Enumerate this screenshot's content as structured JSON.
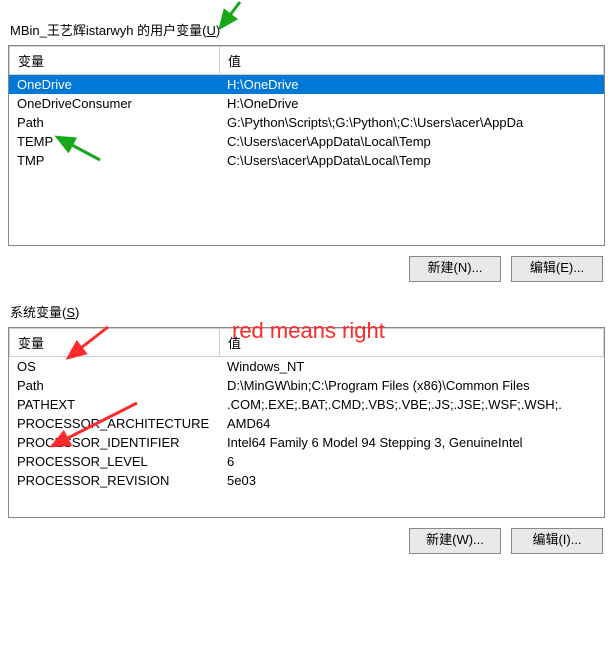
{
  "userSection": {
    "title": "MBin_王艺辉istarwyh 的用户变量(",
    "accelerator": "U",
    "closingParen": ")",
    "columns": {
      "name": "变量",
      "value": "值"
    },
    "rows": [
      {
        "name": "OneDrive",
        "value": "H:\\OneDrive",
        "selected": true
      },
      {
        "name": "OneDriveConsumer",
        "value": "H:\\OneDrive"
      },
      {
        "name": "Path",
        "value": "G:\\Python\\Scripts\\;G:\\Python\\;C:\\Users\\acer\\AppDa"
      },
      {
        "name": "TEMP",
        "value": "C:\\Users\\acer\\AppData\\Local\\Temp"
      },
      {
        "name": "TMP",
        "value": "C:\\Users\\acer\\AppData\\Local\\Temp"
      }
    ],
    "buttons": {
      "new": "新建(N)...",
      "edit": "编辑(E)..."
    }
  },
  "systemSection": {
    "title": "系统变量(",
    "accelerator": "S",
    "closingParen": ")",
    "columns": {
      "name": "变量",
      "value": "值"
    },
    "rows": [
      {
        "name": "OS",
        "value": "Windows_NT"
      },
      {
        "name": "Path",
        "value": "D:\\MinGW\\bin;C:\\Program Files (x86)\\Common Files"
      },
      {
        "name": "PATHEXT",
        "value": ".COM;.EXE;.BAT;.CMD;.VBS;.VBE;.JS;.JSE;.WSF;.WSH;."
      },
      {
        "name": "PROCESSOR_ARCHITECTURE",
        "value": "AMD64"
      },
      {
        "name": "PROCESSOR_IDENTIFIER",
        "value": "Intel64 Family 6 Model 94 Stepping 3, GenuineIntel"
      },
      {
        "name": "PROCESSOR_LEVEL",
        "value": "6"
      },
      {
        "name": "PROCESSOR_REVISION",
        "value": "5e03"
      }
    ],
    "buttons": {
      "new": "新建(W)...",
      "edit": "编辑(I)..."
    }
  },
  "annotation": {
    "text": "red means right"
  },
  "colors": {
    "selection": "#0078d7",
    "red": "#ff2a2a",
    "green": "#17a81a"
  }
}
